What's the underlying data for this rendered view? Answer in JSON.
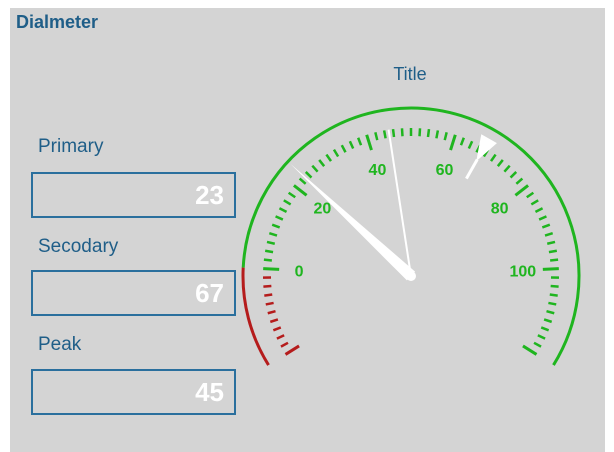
{
  "panel": {
    "title": "Dialmeter"
  },
  "readouts": [
    {
      "label": "Primary",
      "value": "23"
    },
    {
      "label": "Secodary",
      "value": "67"
    },
    {
      "label": "Peak",
      "value": "45"
    }
  ],
  "gauge": {
    "title": "Title",
    "scale": {
      "min": -20,
      "max": 120,
      "tick_labels": [
        "0",
        "20",
        "40",
        "60",
        "80",
        "100"
      ],
      "danger_below": 0
    },
    "primary_needle": 23,
    "secondary_marker": 67,
    "peak_needle": 45,
    "colors": {
      "scale": "#1fb51f",
      "danger": "#b51c1c",
      "needle": "#ffffff",
      "label": "#1f5e88"
    }
  }
}
